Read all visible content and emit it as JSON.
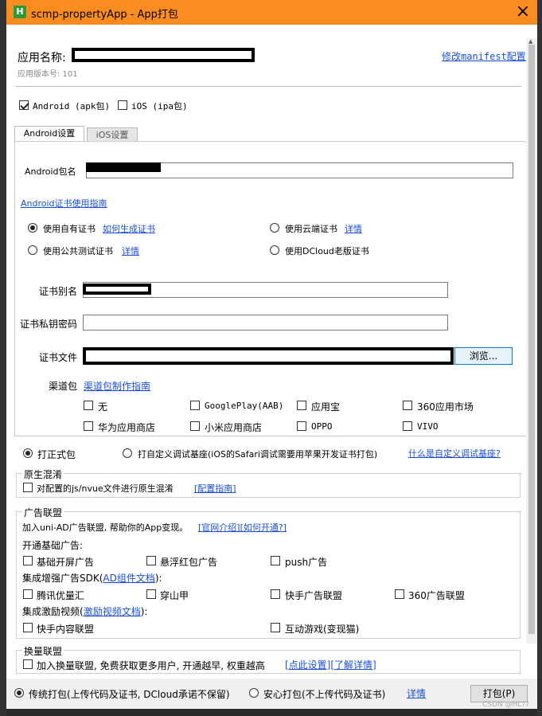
{
  "window": {
    "title": "scmp-propertyApp - App打包",
    "icon_letter": "H",
    "close": "×"
  },
  "header": {
    "app_name_label": "应用名称:",
    "version_label": "应用版本号: 101",
    "manifest_link": "修改manifest配置"
  },
  "platforms": {
    "android": {
      "label": "Android (apk包)",
      "checked": true
    },
    "ios": {
      "label": "iOS (ipa包)",
      "checked": false
    }
  },
  "tabs": [
    {
      "label": "Android设置",
      "active": true
    },
    {
      "label": "iOS设置",
      "active": false
    }
  ],
  "android": {
    "package_label": "Android包名",
    "cert_guide_link": "Android证书使用指南",
    "cert_options": {
      "own": {
        "label": "使用自有证书",
        "link": "如何生成证书",
        "selected": true
      },
      "cloud": {
        "label": "使用云端证书",
        "link": "详情",
        "selected": false
      },
      "public": {
        "label": "使用公共测试证书",
        "link": "详情",
        "selected": false
      },
      "dcloud_old": {
        "label": "使用DCloud老版证书",
        "selected": false
      }
    },
    "alias_label": "证书别名",
    "password_label": "证书私钥密码",
    "file_label": "证书文件",
    "browse_button": "浏览...",
    "channel_label": "渠道包",
    "channel_guide_link": "渠道包制作指南",
    "channels": [
      {
        "label": "无",
        "checked": false
      },
      {
        "label": "GooglePlay(AAB)",
        "checked": false
      },
      {
        "label": "应用宝",
        "checked": false
      },
      {
        "label": "360应用市场",
        "checked": false
      },
      {
        "label": "华为应用商店",
        "checked": false
      },
      {
        "label": "小米应用商店",
        "checked": false
      },
      {
        "label": "OPPO",
        "checked": false
      },
      {
        "label": "VIVO",
        "checked": false
      }
    ]
  },
  "build_type": {
    "formal": {
      "label": "打正式包",
      "selected": true
    },
    "custom_base": {
      "label": "打自定义调试基座(iOS的Safari调试需要用苹果开发证书打包)",
      "selected": false
    },
    "custom_base_link": "什么是自定义调试基座?"
  },
  "obfuscation": {
    "title": "原生混淆",
    "checkbox_label": "对配置的js/nvue文件进行原生混淆",
    "guide_link": "[配置指南]"
  },
  "ads": {
    "title": "广告联盟",
    "intro": "加入uni-AD广告联盟, 帮助你的App变现。",
    "intro_link": "[官网介绍][如何开通?]",
    "basic_title": "开通基础广告:",
    "basic": [
      {
        "label": "基础开屏广告",
        "checked": false
      },
      {
        "label": "悬浮红包广告",
        "checked": false
      },
      {
        "label": "push广告",
        "checked": false
      }
    ],
    "sdk_title_prefix": "集成增强广告SDK(",
    "sdk_title_link": "AD组件文档",
    "sdk_title_suffix": "):",
    "sdk": [
      {
        "label": "腾讯优量汇",
        "checked": false
      },
      {
        "label": "穿山甲",
        "checked": false
      },
      {
        "label": "快手广告联盟",
        "checked": false
      },
      {
        "label": "360广告联盟",
        "checked": false
      }
    ],
    "video_title_prefix": "集成激励视频(",
    "video_title_link": "激励视频文档",
    "video_title_suffix": "):",
    "video": [
      {
        "label": "快手内容联盟",
        "checked": false
      },
      {
        "label": "互动游戏(变现猫)",
        "checked": false
      }
    ]
  },
  "exchange": {
    "title": "换量联盟",
    "checkbox_label": "加入换量联盟, 免费获取更多用户, 开通越早, 权重越高",
    "link": "[点此设置][了解详情]"
  },
  "footer": {
    "traditional": {
      "label": "传统打包(上传代码及证书, DCloud承诺不保留)",
      "selected": true
    },
    "secure": {
      "label": "安心打包(不上传代码及证书)",
      "selected": false
    },
    "details_link": "详情",
    "pack_button": "打包(P)",
    "watermark": "CSDN @HL??"
  }
}
